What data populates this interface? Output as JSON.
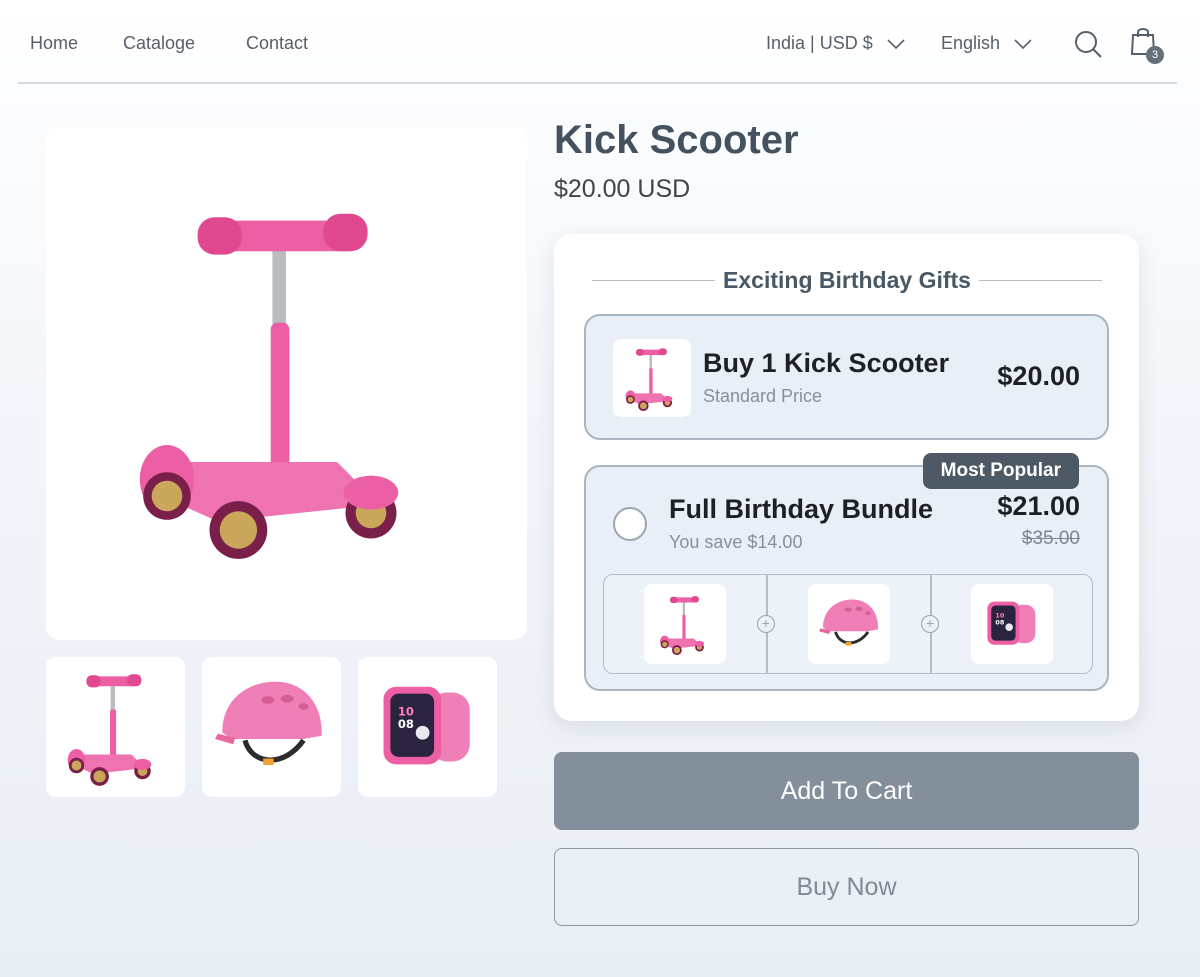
{
  "nav": {
    "links": [
      "Home",
      "Cataloge",
      "Contact"
    ],
    "country_selector": "India | USD $",
    "language_selector": "English",
    "cart_count": "3"
  },
  "product": {
    "title": "Kick Scooter",
    "price": "$20.00 USD"
  },
  "offer": {
    "heading": "Exciting Birthday Gifts",
    "option_single": {
      "title": "Buy 1 Kick Scooter",
      "subtitle": "Standard Price",
      "price": "$20.00"
    },
    "option_bundle": {
      "badge": "Most Popular",
      "title": "Full Birthday Bundle",
      "subtitle": "You save $14.00",
      "price": "$21.00",
      "original_price": "$35.00",
      "items": [
        "kick-scooter",
        "helmet",
        "smartwatch"
      ]
    }
  },
  "buttons": {
    "add_to_cart": "Add To Cart",
    "buy_now": "Buy Now"
  },
  "colors": {
    "product_pink": "#ec5fa4",
    "add_to_cart_bg": "#838f9b",
    "badge_bg": "#4d5a66"
  }
}
